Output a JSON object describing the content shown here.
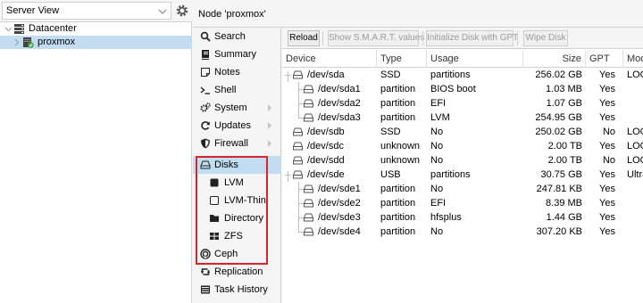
{
  "sidebar": {
    "view_selector": "Server View",
    "tree": [
      {
        "label": "Datacenter"
      },
      {
        "label": "proxmox"
      }
    ]
  },
  "header": {
    "title": "Node 'proxmox'"
  },
  "nav": {
    "items": [
      {
        "label": "Search",
        "icon": "search-icon"
      },
      {
        "label": "Summary",
        "icon": "book-icon"
      },
      {
        "label": "Notes",
        "icon": "notes-icon"
      },
      {
        "label": "Shell",
        "icon": "terminal-icon"
      },
      {
        "label": "System",
        "icon": "gears-icon"
      },
      {
        "label": "Updates",
        "icon": "refresh-icon"
      },
      {
        "label": "Firewall",
        "icon": "shield-icon"
      },
      {
        "label": "Disks",
        "icon": "disk-icon"
      },
      {
        "label": "LVM",
        "icon": "square-filled-icon"
      },
      {
        "label": "LVM-Thin",
        "icon": "square-outline-icon"
      },
      {
        "label": "Directory",
        "icon": "folder-icon"
      },
      {
        "label": "ZFS",
        "icon": "grid-icon"
      },
      {
        "label": "Ceph",
        "icon": "ceph-icon"
      },
      {
        "label": "Replication",
        "icon": "retweet-icon"
      },
      {
        "label": "Task History",
        "icon": "list-icon"
      }
    ],
    "selected": "Disks"
  },
  "toolbar": {
    "reload": "Reload",
    "smart": "Show S.M.A.R.T. values",
    "init_disk": "Initialize Disk with GPT",
    "wipe": "Wipe Disk"
  },
  "grid": {
    "columns": [
      "Device",
      "Type",
      "Usage",
      "Size",
      "GPT",
      "Mod"
    ],
    "rows": [
      {
        "device": "/dev/sda",
        "type": "SSD",
        "usage": "partitions",
        "size": "256.02 GB",
        "gpt": "Yes",
        "model": "LOG"
      },
      {
        "device": "/dev/sda1",
        "type": "partition",
        "usage": "BIOS boot",
        "size": "1.03 MB",
        "gpt": "Yes",
        "model": ""
      },
      {
        "device": "/dev/sda2",
        "type": "partition",
        "usage": "EFI",
        "size": "1.07 GB",
        "gpt": "Yes",
        "model": ""
      },
      {
        "device": "/dev/sda3",
        "type": "partition",
        "usage": "LVM",
        "size": "254.95 GB",
        "gpt": "Yes",
        "model": ""
      },
      {
        "device": "/dev/sdb",
        "type": "SSD",
        "usage": "No",
        "size": "250.02 GB",
        "gpt": "No",
        "model": "LOG"
      },
      {
        "device": "/dev/sdc",
        "type": "unknown",
        "usage": "No",
        "size": "2.00 TB",
        "gpt": "Yes",
        "model": "LOG"
      },
      {
        "device": "/dev/sdd",
        "type": "unknown",
        "usage": "No",
        "size": "2.00 TB",
        "gpt": "No",
        "model": "LOG"
      },
      {
        "device": "/dev/sde",
        "type": "USB",
        "usage": "partitions",
        "size": "30.75 GB",
        "gpt": "Yes",
        "model": "Ultra"
      },
      {
        "device": "/dev/sde1",
        "type": "partition",
        "usage": "No",
        "size": "247.81 KB",
        "gpt": "Yes",
        "model": ""
      },
      {
        "device": "/dev/sde2",
        "type": "partition",
        "usage": "EFI",
        "size": "8.39 MB",
        "gpt": "Yes",
        "model": ""
      },
      {
        "device": "/dev/sde3",
        "type": "partition",
        "usage": "hfsplus",
        "size": "1.44 GB",
        "gpt": "Yes",
        "model": ""
      },
      {
        "device": "/dev/sde4",
        "type": "partition",
        "usage": "No",
        "size": "307.20 KB",
        "gpt": "Yes",
        "model": ""
      }
    ]
  },
  "colors": {
    "selection": "#c2ddf2",
    "highlight_box": "#d9262d",
    "node_online": "#3fa63f"
  }
}
